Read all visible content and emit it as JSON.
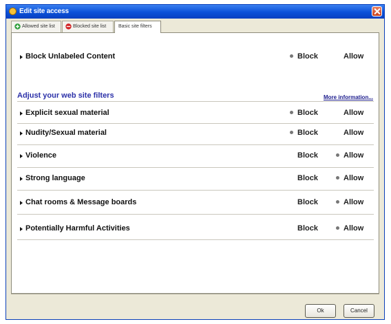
{
  "window": {
    "title": "Edit site access",
    "close_icon": "close-icon"
  },
  "tabs": [
    {
      "label": "Allowed site list",
      "icon": "green-plus-icon"
    },
    {
      "label": "Blocked site list",
      "icon": "red-block-icon"
    },
    {
      "label": "Basic site filters",
      "active": true
    }
  ],
  "top_filter": {
    "label": "Block Unlabeled Content",
    "selected": "Block"
  },
  "section": {
    "title": "Adjust your web site filters",
    "more_link": "More information..."
  },
  "option_labels": {
    "block": "Block",
    "allow": "Allow"
  },
  "filters": [
    {
      "label": "Explicit sexual material",
      "selected": "Block"
    },
    {
      "label": "Nudity/Sexual material",
      "selected": "Block"
    },
    {
      "label": "Violence",
      "selected": "Allow"
    },
    {
      "label": "Strong language",
      "selected": "Allow"
    },
    {
      "label": "Chat rooms & Message boards",
      "selected": "Allow"
    },
    {
      "label": "Potentially Harmful Activities",
      "selected": "Allow"
    }
  ],
  "buttons": {
    "ok": "Ok",
    "cancel": "Cancel"
  },
  "colors": {
    "title_bar": "#0a50d8",
    "section_title": "#2b30a8",
    "window_bg": "#ece9d8"
  }
}
